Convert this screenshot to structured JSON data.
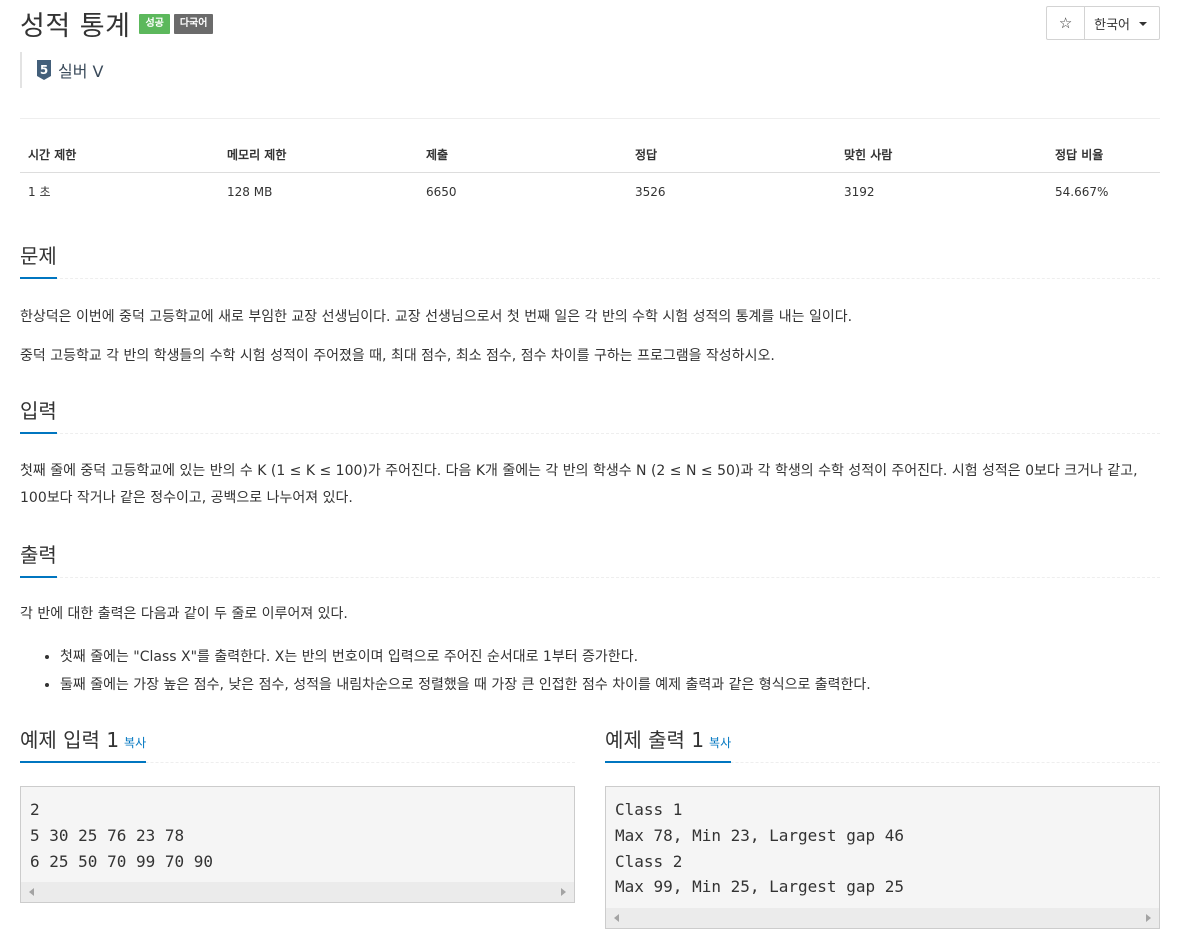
{
  "problem": {
    "title": "성적 통계",
    "badges": {
      "success": "성공",
      "multilang": "다국어"
    },
    "tier": {
      "number": "5",
      "label": "실버 V",
      "color": "#435f7a"
    }
  },
  "toolbar": {
    "star": "☆",
    "language": "한국어"
  },
  "info_table": {
    "headers": [
      "시간 제한",
      "메모리 제한",
      "제출",
      "정답",
      "맞힌 사람",
      "정답 비율"
    ],
    "values": [
      "1 초",
      "128 MB",
      "6650",
      "3526",
      "3192",
      "54.667%"
    ]
  },
  "sections": {
    "description": {
      "heading": "문제",
      "paragraphs": [
        "한상덕은 이번에 중덕 고등학교에 새로 부임한 교장 선생님이다. 교장 선생님으로서 첫 번째 일은 각 반의 수학 시험 성적의 통계를 내는 일이다.",
        "중덕 고등학교 각 반의 학생들의 수학 시험 성적이 주어졌을 때, 최대 점수, 최소 점수, 점수 차이를 구하는 프로그램을 작성하시오."
      ]
    },
    "input": {
      "heading": "입력",
      "text": "첫째 줄에 중덕 고등학교에 있는 반의 수 K (1 ≤ K ≤ 100)가 주어진다. 다음 K개 줄에는 각 반의 학생수 N (2 ≤ N ≤ 50)과 각 학생의 수학 성적이 주어진다. 시험 성적은 0보다 크거나 같고, 100보다 작거나 같은 정수이고, 공백으로 나누어져 있다."
    },
    "output": {
      "heading": "출력",
      "text": "각 반에 대한 출력은 다음과 같이 두 줄로 이루어져 있다.",
      "bullets": [
        "첫째 줄에는 \"Class X\"를 출력한다. X는 반의 번호이며 입력으로 주어진 순서대로 1부터 증가한다.",
        "둘째 줄에는 가장 높은 점수, 낮은 점수, 성적을 내림차순으로 정렬했을 때 가장 큰 인접한 점수 차이를 예제 출력과 같은 형식으로 출력한다."
      ]
    }
  },
  "samples": {
    "input": {
      "heading": "예제 입력 1",
      "copy": "복사",
      "content": "2\n5 30 25 76 23 78\n6 25 50 70 99 70 90"
    },
    "output": {
      "heading": "예제 출력 1",
      "copy": "복사",
      "content": "Class 1\nMax 78, Min 23, Largest gap 46\nClass 2\nMax 99, Min 25, Largest gap 25"
    }
  }
}
